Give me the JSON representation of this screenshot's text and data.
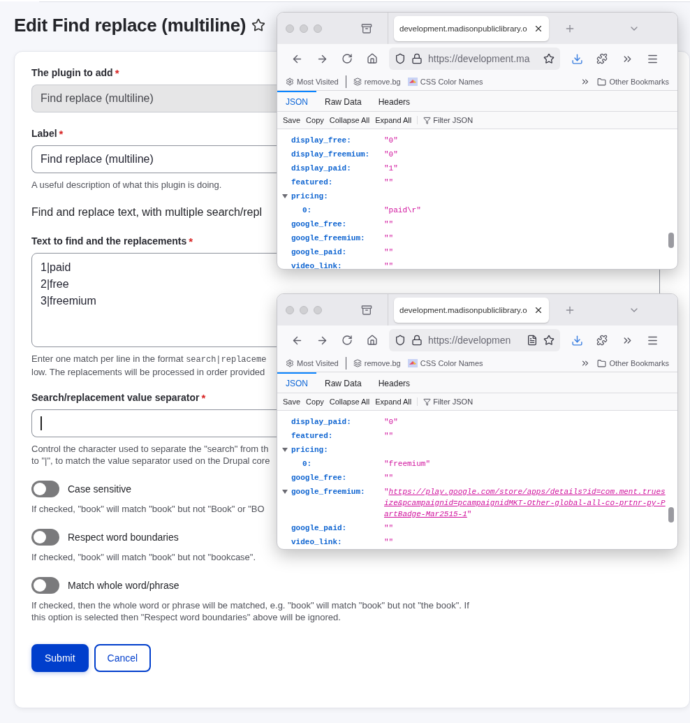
{
  "page_title": "Edit Find replace (multiline)",
  "form": {
    "plugin_field": {
      "label": "The plugin to add",
      "required_mark": "*",
      "value": "Find replace (multiline)",
      "disabled": true
    },
    "label_field": {
      "label": "Label",
      "required_mark": "*",
      "value": "Find replace (multiline)",
      "disabled": false,
      "description": "A useful description of what this plugin is doing."
    },
    "intro": "Find and replace text, with multiple search/repl",
    "replacements_field": {
      "label": "Text to find and the replacements",
      "required_mark": "*",
      "lines": [
        "1|paid",
        "2|free",
        "3|freemium"
      ],
      "help": [
        {
          "text": "Enter one match per line in the format ",
          "code": "search|replaceme"
        },
        {
          "text": "low. The replacements will be processed in order provided"
        }
      ]
    },
    "separator_field": {
      "label": "Search/replacement value separator",
      "required_mark": "*",
      "focused": true,
      "help": [
        "Control the character used to separate the \"search\" from th",
        "to \"|\", to match the value separator used on the Drupal core"
      ]
    },
    "options": [
      {
        "label": "Case sensitive",
        "on": false,
        "help": "If checked, \"book\" will match \"book\" but not \"Book\" or \"BO"
      },
      {
        "label": "Respect word boundaries",
        "on": false,
        "help": "If checked, \"book\" will match \"book\" but not \"bookcase\"."
      },
      {
        "label": "Match whole word/phrase",
        "on": false,
        "help": "If checked, then the whole word or phrase will be matched, e.g. \"book\" will match \"book\" but not \"the book\". If this option is selected then \"Respect word boundaries\" above will be ignored."
      }
    ],
    "buttons": [
      {
        "label": "Submit",
        "kind": "primary"
      },
      {
        "label": "Cancel",
        "kind": "secondary"
      }
    ]
  },
  "browser_windows": [
    {
      "tab_title": "development.madisonpubliclibrary.o",
      "url": "https://development.ma",
      "reader_view": false,
      "bookmarks": [
        "Most Visited",
        "remove.bg",
        "CSS Color Names"
      ],
      "other_bookmarks": "Other Bookmarks",
      "viewer_tabs": [
        {
          "label": "JSON",
          "selected": true
        },
        {
          "label": "Raw Data",
          "selected": false
        },
        {
          "label": "Headers",
          "selected": false
        }
      ],
      "actions": [
        "Save",
        "Copy",
        "Collapse All",
        "Expand All"
      ],
      "filter_placeholder": "Filter JSON",
      "rows": [
        {
          "key": "display_free:",
          "value": "\"0\""
        },
        {
          "key": "display_freemium:",
          "value": "\"0\""
        },
        {
          "key": "display_paid:",
          "value": "\"1\""
        },
        {
          "key": "featured:",
          "value": "\"\""
        },
        {
          "key": "pricing:",
          "expanded": true,
          "children": [
            {
              "key": "0:",
              "value": "\"paid\\r\""
            }
          ]
        },
        {
          "key": "google_free:",
          "value": "\"\""
        },
        {
          "key": "google_freemium:",
          "value": "\"\""
        },
        {
          "key": "google_paid:",
          "value": "\"\""
        },
        {
          "key": "video_link:",
          "value": "\"\""
        }
      ]
    },
    {
      "tab_title": "development.madisonpubliclibrary.o",
      "url": "https://developmen",
      "reader_view": true,
      "bookmarks": [
        "Most Visited",
        "remove.bg",
        "CSS Color Names"
      ],
      "other_bookmarks": "Other Bookmarks",
      "viewer_tabs": [
        {
          "label": "JSON",
          "selected": true
        },
        {
          "label": "Raw Data",
          "selected": false
        },
        {
          "label": "Headers",
          "selected": false
        }
      ],
      "actions": [
        "Save",
        "Copy",
        "Collapse All",
        "Expand All"
      ],
      "filter_placeholder": "Filter JSON",
      "rows": [
        {
          "key": "display_paid:",
          "value": "\"0\""
        },
        {
          "key": "featured:",
          "value": "\"\""
        },
        {
          "key": "pricing:",
          "expanded": true,
          "children": [
            {
              "key": "0:",
              "value": "\"freemium\""
            }
          ]
        },
        {
          "key": "google_free:",
          "value": "\"\""
        },
        {
          "key": "google_freemium:",
          "expanded": true,
          "kind": "link",
          "value_open": "\"",
          "link": "https://play.google.com/store/apps/details?id=com.ment.truesize&pcampaignid=pcampaignidMKT-Other-global-all-co-prtnr-py-PartBadge-Mar2515-1",
          "value_close": "\""
        },
        {
          "key": "google_paid:",
          "value": "\"\""
        },
        {
          "key": "video_link:",
          "value": "\"\""
        }
      ]
    }
  ]
}
